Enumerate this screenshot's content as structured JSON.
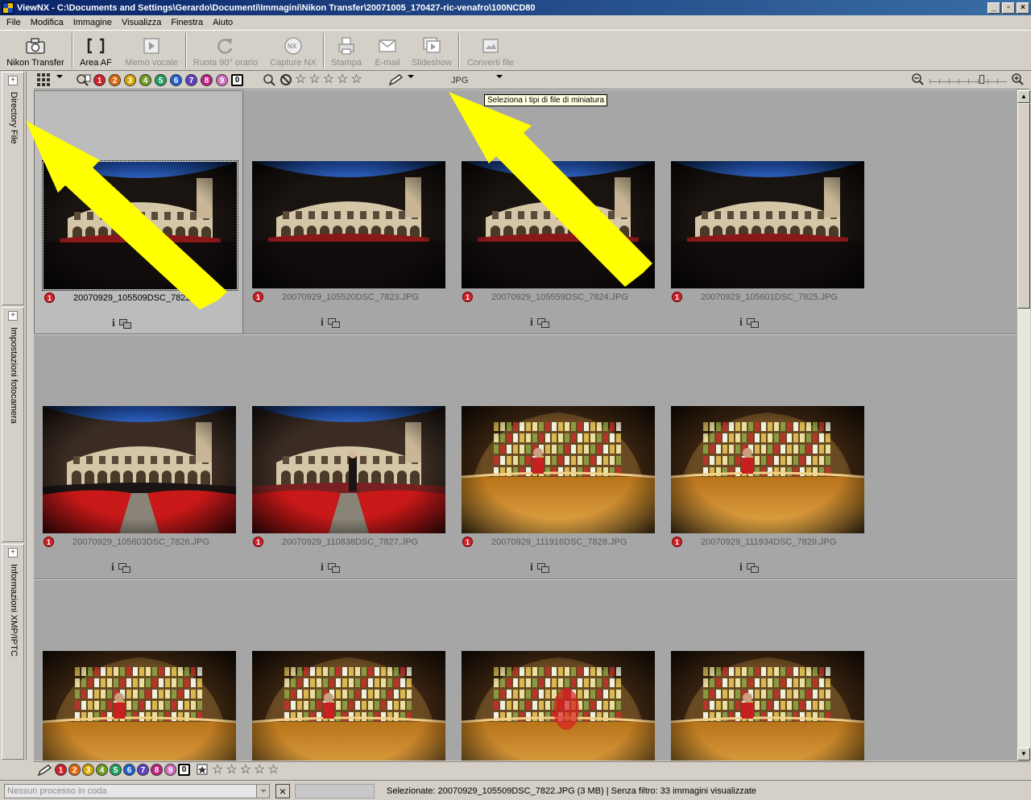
{
  "window": {
    "title": "ViewNX - C:\\Documents and Settings\\Gerardo\\Documenti\\Immagini\\Nikon Transfer\\20071005_170427-ric-venafro\\100NCD80",
    "min": "_",
    "max": "▫",
    "close": "×"
  },
  "menu": [
    "File",
    "Modifica",
    "Immagine",
    "Visualizza",
    "Finestra",
    "Aiuto"
  ],
  "toolbar": {
    "nikon_transfer": "Nikon Transfer",
    "area_af": "Area AF",
    "memo_vocale": "Memo vocale",
    "ruota": "Ruota 90° orario",
    "capture_nx": "Capture NX",
    "stampa": "Stampa",
    "email": "E-mail",
    "slideshow": "Slideshow",
    "converti": "Converti file"
  },
  "left_panels": [
    "Directory File",
    "Impostazioni fotocamera",
    "Informazioni XMP/IPTC"
  ],
  "filter": {
    "labels": [
      "1",
      "2",
      "3",
      "4",
      "5",
      "6",
      "7",
      "8",
      "9",
      "0"
    ],
    "label_colors": [
      "#d0202a",
      "#e06a10",
      "#d8a800",
      "#70a020",
      "#20a060",
      "#2060d0",
      "#6040c0",
      "#c02080",
      "#d070c0"
    ],
    "file_type": "JPG",
    "tooltip": "Seleziona i tipi di file di miniatura"
  },
  "thumbnails": [
    {
      "name": "20070929_105509DSC_7822.JPG",
      "label": "1",
      "scene": "cloister-dark",
      "selected": true
    },
    {
      "name": "20070929_105520DSC_7823.JPG",
      "label": "1",
      "scene": "cloister-dark",
      "selected": false
    },
    {
      "name": "20070929_105559DSC_7824.JPG",
      "label": "1",
      "scene": "cloister-dark",
      "selected": false
    },
    {
      "name": "20070929_105601DSC_7825.JPG",
      "label": "1",
      "scene": "cloister-dark",
      "selected": false
    },
    {
      "name": "20070929_105603DSC_7826.JPG",
      "label": "1",
      "scene": "cloister-path",
      "selected": false
    },
    {
      "name": "20070929_110838DSC_7827.JPG",
      "label": "1",
      "scene": "cloister-flowers",
      "selected": false
    },
    {
      "name": "20070929_111916DSC_7828.JPG",
      "label": "1",
      "scene": "bar",
      "selected": false
    },
    {
      "name": "20070929_111934DSC_7829.JPG",
      "label": "1",
      "scene": "bar",
      "selected": false
    },
    {
      "name": "",
      "label": "",
      "scene": "bar",
      "selected": false
    },
    {
      "name": "",
      "label": "",
      "scene": "bar",
      "selected": false
    },
    {
      "name": "",
      "label": "",
      "scene": "bar-blur",
      "selected": false
    },
    {
      "name": "",
      "label": "",
      "scene": "bar",
      "selected": false
    }
  ],
  "icons": {
    "info": "i"
  },
  "status": {
    "queue": "Nessun processo in coda",
    "cancel": "×",
    "text": "Selezionate: 20070929_105509DSC_7822.JPG (3 MB) | Senza filtro: 33 immagini visualizzate"
  }
}
